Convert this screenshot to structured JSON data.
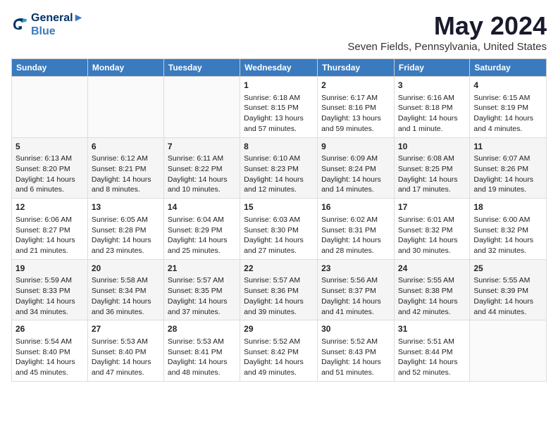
{
  "header": {
    "logo_line1": "General",
    "logo_line2": "Blue",
    "month": "May 2024",
    "location": "Seven Fields, Pennsylvania, United States"
  },
  "weekdays": [
    "Sunday",
    "Monday",
    "Tuesday",
    "Wednesday",
    "Thursday",
    "Friday",
    "Saturday"
  ],
  "weeks": [
    [
      {
        "day": "",
        "info": ""
      },
      {
        "day": "",
        "info": ""
      },
      {
        "day": "",
        "info": ""
      },
      {
        "day": "1",
        "info": "Sunrise: 6:18 AM\nSunset: 8:15 PM\nDaylight: 13 hours and 57 minutes."
      },
      {
        "day": "2",
        "info": "Sunrise: 6:17 AM\nSunset: 8:16 PM\nDaylight: 13 hours and 59 minutes."
      },
      {
        "day": "3",
        "info": "Sunrise: 6:16 AM\nSunset: 8:18 PM\nDaylight: 14 hours and 1 minute."
      },
      {
        "day": "4",
        "info": "Sunrise: 6:15 AM\nSunset: 8:19 PM\nDaylight: 14 hours and 4 minutes."
      }
    ],
    [
      {
        "day": "5",
        "info": "Sunrise: 6:13 AM\nSunset: 8:20 PM\nDaylight: 14 hours and 6 minutes."
      },
      {
        "day": "6",
        "info": "Sunrise: 6:12 AM\nSunset: 8:21 PM\nDaylight: 14 hours and 8 minutes."
      },
      {
        "day": "7",
        "info": "Sunrise: 6:11 AM\nSunset: 8:22 PM\nDaylight: 14 hours and 10 minutes."
      },
      {
        "day": "8",
        "info": "Sunrise: 6:10 AM\nSunset: 8:23 PM\nDaylight: 14 hours and 12 minutes."
      },
      {
        "day": "9",
        "info": "Sunrise: 6:09 AM\nSunset: 8:24 PM\nDaylight: 14 hours and 14 minutes."
      },
      {
        "day": "10",
        "info": "Sunrise: 6:08 AM\nSunset: 8:25 PM\nDaylight: 14 hours and 17 minutes."
      },
      {
        "day": "11",
        "info": "Sunrise: 6:07 AM\nSunset: 8:26 PM\nDaylight: 14 hours and 19 minutes."
      }
    ],
    [
      {
        "day": "12",
        "info": "Sunrise: 6:06 AM\nSunset: 8:27 PM\nDaylight: 14 hours and 21 minutes."
      },
      {
        "day": "13",
        "info": "Sunrise: 6:05 AM\nSunset: 8:28 PM\nDaylight: 14 hours and 23 minutes."
      },
      {
        "day": "14",
        "info": "Sunrise: 6:04 AM\nSunset: 8:29 PM\nDaylight: 14 hours and 25 minutes."
      },
      {
        "day": "15",
        "info": "Sunrise: 6:03 AM\nSunset: 8:30 PM\nDaylight: 14 hours and 27 minutes."
      },
      {
        "day": "16",
        "info": "Sunrise: 6:02 AM\nSunset: 8:31 PM\nDaylight: 14 hours and 28 minutes."
      },
      {
        "day": "17",
        "info": "Sunrise: 6:01 AM\nSunset: 8:32 PM\nDaylight: 14 hours and 30 minutes."
      },
      {
        "day": "18",
        "info": "Sunrise: 6:00 AM\nSunset: 8:32 PM\nDaylight: 14 hours and 32 minutes."
      }
    ],
    [
      {
        "day": "19",
        "info": "Sunrise: 5:59 AM\nSunset: 8:33 PM\nDaylight: 14 hours and 34 minutes."
      },
      {
        "day": "20",
        "info": "Sunrise: 5:58 AM\nSunset: 8:34 PM\nDaylight: 14 hours and 36 minutes."
      },
      {
        "day": "21",
        "info": "Sunrise: 5:57 AM\nSunset: 8:35 PM\nDaylight: 14 hours and 37 minutes."
      },
      {
        "day": "22",
        "info": "Sunrise: 5:57 AM\nSunset: 8:36 PM\nDaylight: 14 hours and 39 minutes."
      },
      {
        "day": "23",
        "info": "Sunrise: 5:56 AM\nSunset: 8:37 PM\nDaylight: 14 hours and 41 minutes."
      },
      {
        "day": "24",
        "info": "Sunrise: 5:55 AM\nSunset: 8:38 PM\nDaylight: 14 hours and 42 minutes."
      },
      {
        "day": "25",
        "info": "Sunrise: 5:55 AM\nSunset: 8:39 PM\nDaylight: 14 hours and 44 minutes."
      }
    ],
    [
      {
        "day": "26",
        "info": "Sunrise: 5:54 AM\nSunset: 8:40 PM\nDaylight: 14 hours and 45 minutes."
      },
      {
        "day": "27",
        "info": "Sunrise: 5:53 AM\nSunset: 8:40 PM\nDaylight: 14 hours and 47 minutes."
      },
      {
        "day": "28",
        "info": "Sunrise: 5:53 AM\nSunset: 8:41 PM\nDaylight: 14 hours and 48 minutes."
      },
      {
        "day": "29",
        "info": "Sunrise: 5:52 AM\nSunset: 8:42 PM\nDaylight: 14 hours and 49 minutes."
      },
      {
        "day": "30",
        "info": "Sunrise: 5:52 AM\nSunset: 8:43 PM\nDaylight: 14 hours and 51 minutes."
      },
      {
        "day": "31",
        "info": "Sunrise: 5:51 AM\nSunset: 8:44 PM\nDaylight: 14 hours and 52 minutes."
      },
      {
        "day": "",
        "info": ""
      }
    ]
  ]
}
